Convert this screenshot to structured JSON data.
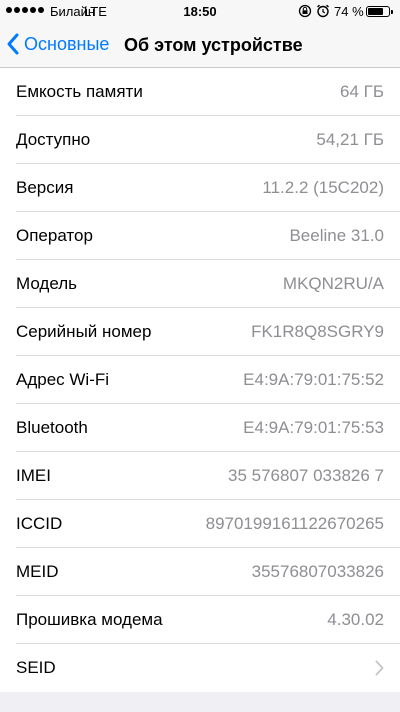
{
  "status_bar": {
    "carrier": "Билайн",
    "network": "LTE",
    "time": "18:50",
    "battery_percent": "74 %",
    "battery_level": 0.74,
    "icons": [
      "signal-dots",
      "lock-rotation-icon",
      "alarm-icon",
      "battery-icon"
    ]
  },
  "nav": {
    "back_label": "Основные",
    "title": "Об этом устройстве",
    "accent_color": "#007aff"
  },
  "rows": [
    {
      "label": "Емкость памяти",
      "value": "64 ГБ"
    },
    {
      "label": "Доступно",
      "value": "54,21 ГБ"
    },
    {
      "label": "Версия",
      "value": "11.2.2 (15C202)"
    },
    {
      "label": "Оператор",
      "value": "Beeline 31.0"
    },
    {
      "label": "Модель",
      "value": "MKQN2RU/A"
    },
    {
      "label": "Серийный номер",
      "value": "FK1R8Q8SGRY9"
    },
    {
      "label": "Адрес Wi-Fi",
      "value": "E4:9A:79:01:75:52"
    },
    {
      "label": "Bluetooth",
      "value": "E4:9A:79:01:75:53"
    },
    {
      "label": "IMEI",
      "value": "35 576807 033826 7"
    },
    {
      "label": "ICCID",
      "value": "8970199161122670265"
    },
    {
      "label": "MEID",
      "value": "35576807033826"
    },
    {
      "label": "Прошивка модема",
      "value": "4.30.02"
    },
    {
      "label": "SEID",
      "value": ""
    }
  ]
}
